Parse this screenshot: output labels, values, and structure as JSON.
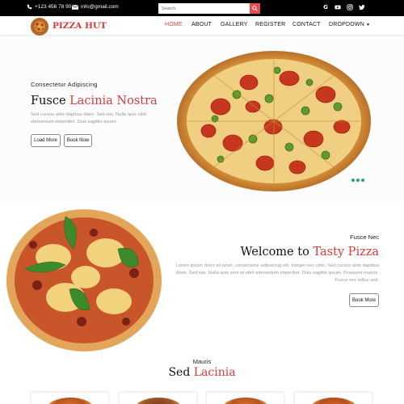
{
  "topbar": {
    "phone": "+123 456 78 90",
    "email": "info@gmail.com",
    "search_placeholder": "Search",
    "social": [
      "google-icon",
      "youtube-icon",
      "instagram-icon",
      "twitter-icon"
    ]
  },
  "nav": {
    "brand": "PIZZA HUT",
    "items": [
      "HOME",
      "ABOUT",
      "GALLERY",
      "REGISTER",
      "CONTACT",
      "DROPDOWN"
    ],
    "active": "HOME"
  },
  "hero1": {
    "kicker": "Consectetur Adipiscing",
    "title_plain": "Fusce ",
    "title_accent": "Lacinia Nostra",
    "description": "Sed cursus ante dapibus diam. Sed nisi. Nulla quis nibh elementum imperdiet. Duis sagittis ipsum.",
    "button_load_more": "Load More",
    "button_book_now": "Book Now",
    "slides": 3
  },
  "hero2": {
    "kicker": "Fusce Nec",
    "title_plain": "Welcome to ",
    "title_accent": "Tasty Pizza",
    "description": "Lorem ipsum dolor sit amet, consectetur adipiscing elit. Integer nec odio. Sed cursus ante dapibus diam. Sed nisi. Nulla quis sem at nibh elementum imperdiet. Duis sagittis ipsum. Praesent mauris. Fusce nec tellus sed.",
    "button_book_more": "Book More"
  },
  "section3": {
    "kicker": "Mauris",
    "title_plain": "Sed ",
    "title_accent": "Lacinia"
  },
  "colors": {
    "accent": "#d43b3b",
    "topbar": "#000000",
    "dot": "#29a36a"
  }
}
